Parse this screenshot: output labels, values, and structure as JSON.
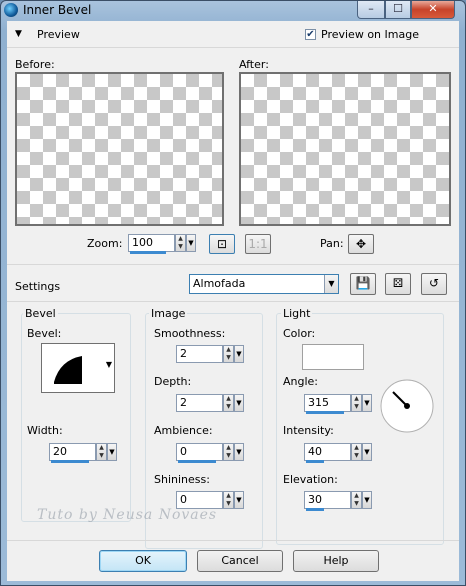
{
  "window": {
    "title": "Inner Bevel"
  },
  "titlebar_buttons": {
    "minimize": "–",
    "maximize": "☐",
    "close": "✕"
  },
  "preview": {
    "header": "Preview",
    "preview_on_image_label": "Preview on Image",
    "preview_on_image_checked": true,
    "before_label": "Before:",
    "after_label": "After:",
    "zoom_label": "Zoom:",
    "zoom_value": "100",
    "pan_label": "Pan:"
  },
  "settings": {
    "label": "Settings",
    "preset_value": "Almofada"
  },
  "bevel": {
    "group_label": "Bevel",
    "bevel_label": "Bevel:",
    "width_label": "Width:",
    "width_value": "20"
  },
  "image": {
    "group_label": "Image",
    "smoothness_label": "Smoothness:",
    "smoothness_value": "2",
    "depth_label": "Depth:",
    "depth_value": "2",
    "ambience_label": "Ambience:",
    "ambience_value": "0",
    "shininess_label": "Shininess:",
    "shininess_value": "0"
  },
  "light": {
    "group_label": "Light",
    "color_label": "Color:",
    "color_value": "#ffffff",
    "angle_label": "Angle:",
    "angle_value": "315",
    "intensity_label": "Intensity:",
    "intensity_value": "40",
    "elevation_label": "Elevation:",
    "elevation_value": "30"
  },
  "watermark": "Tuto by Neusa Novaes",
  "buttons": {
    "ok": "OK",
    "cancel": "Cancel",
    "help": "Help"
  }
}
